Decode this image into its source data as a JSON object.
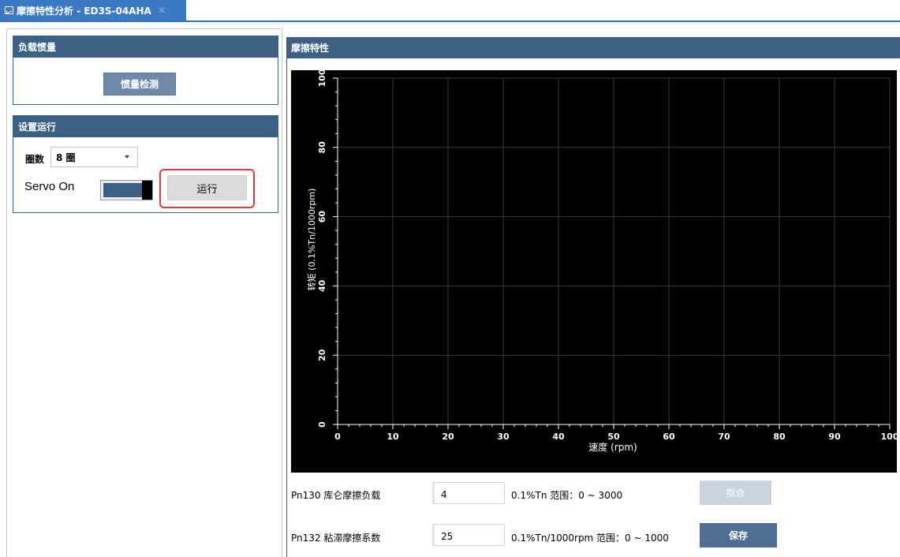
{
  "tab": {
    "title": "摩擦特性分析 - ED3S-04AHA",
    "close": "×"
  },
  "load_inertia": {
    "header": "负载惯量",
    "detect_button": "惯量检测"
  },
  "run_settings": {
    "header": "设置运行",
    "circles_label": "圈数",
    "circles_value": "8 圈",
    "servo_label": "Servo On",
    "run_button": "运行"
  },
  "friction": {
    "header": "摩擦特性"
  },
  "chart_data": {
    "type": "line",
    "xlabel": "速度 (rpm)",
    "ylabel": "转矩 (0.1%Tn/1000rpm)",
    "xlim": [
      0,
      100
    ],
    "ylim": [
      0,
      100
    ],
    "xticks": [
      0,
      10,
      20,
      30,
      40,
      50,
      60,
      70,
      80,
      90,
      100
    ],
    "yticks": [
      0,
      20,
      40,
      60,
      80,
      100
    ],
    "grid": true,
    "series": []
  },
  "params": [
    {
      "label": "Pn130 库仑摩擦负载",
      "value": "4",
      "unit_range": "0.1%Tn  范围：0 ~ 3000",
      "button": "拟合"
    },
    {
      "label": "Pn132 粘滞摩擦系数",
      "value": "25",
      "unit_range": "0.1%Tn/1000rpm  范围：0 ~ 1000",
      "button": "保存"
    }
  ],
  "colors": {
    "accent": "#3c6185",
    "tab": "#3a79c3",
    "highlight": "#e0383b"
  }
}
